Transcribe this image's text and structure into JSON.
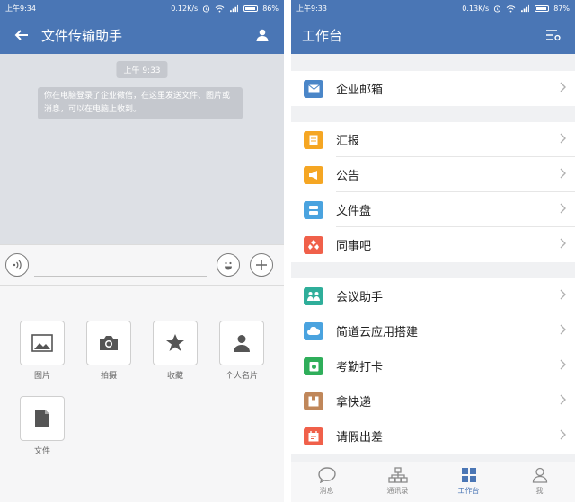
{
  "left": {
    "status": {
      "time": "上午9:34",
      "network": "0.12K/s",
      "battery": "86%"
    },
    "nav": {
      "title": "文件传输助手"
    },
    "chat": {
      "timestamp": "上午 9:33",
      "system_message": "你在电脑登录了企业微信，在这里发送文件、图片或消息，可以在电脑上收到。"
    },
    "tools": [
      "图片",
      "拍摄",
      "收藏",
      "个人名片",
      "文件"
    ]
  },
  "right": {
    "status": {
      "time": "上午9:33",
      "network": "0.13K/s",
      "battery": "87%"
    },
    "nav": {
      "title": "工作台"
    },
    "items": [
      {
        "label": "企业邮箱",
        "color": "#4a86c8",
        "icon": "mail-icon"
      },
      {
        "label": "汇报",
        "color": "#f5a623",
        "icon": "report-icon"
      },
      {
        "label": "公告",
        "color": "#f5a623",
        "icon": "megaphone-icon"
      },
      {
        "label": "文件盘",
        "color": "#4aa3df",
        "icon": "disk-icon"
      },
      {
        "label": "同事吧",
        "color": "#f0604a",
        "icon": "colleague-icon"
      },
      {
        "label": "会议助手",
        "color": "#2fae9a",
        "icon": "meeting-icon"
      },
      {
        "label": "简道云应用搭建",
        "color": "#4aa3df",
        "icon": "cloud-icon"
      },
      {
        "label": "考勤打卡",
        "color": "#2fae5a",
        "icon": "clock-in-icon"
      },
      {
        "label": "拿快递",
        "color": "#c0875a",
        "icon": "package-icon"
      },
      {
        "label": "请假出差",
        "color": "#f0604a",
        "icon": "leave-icon"
      }
    ],
    "tabs": [
      "消息",
      "通讯录",
      "工作台",
      "我"
    ],
    "active_tab": "工作台"
  }
}
